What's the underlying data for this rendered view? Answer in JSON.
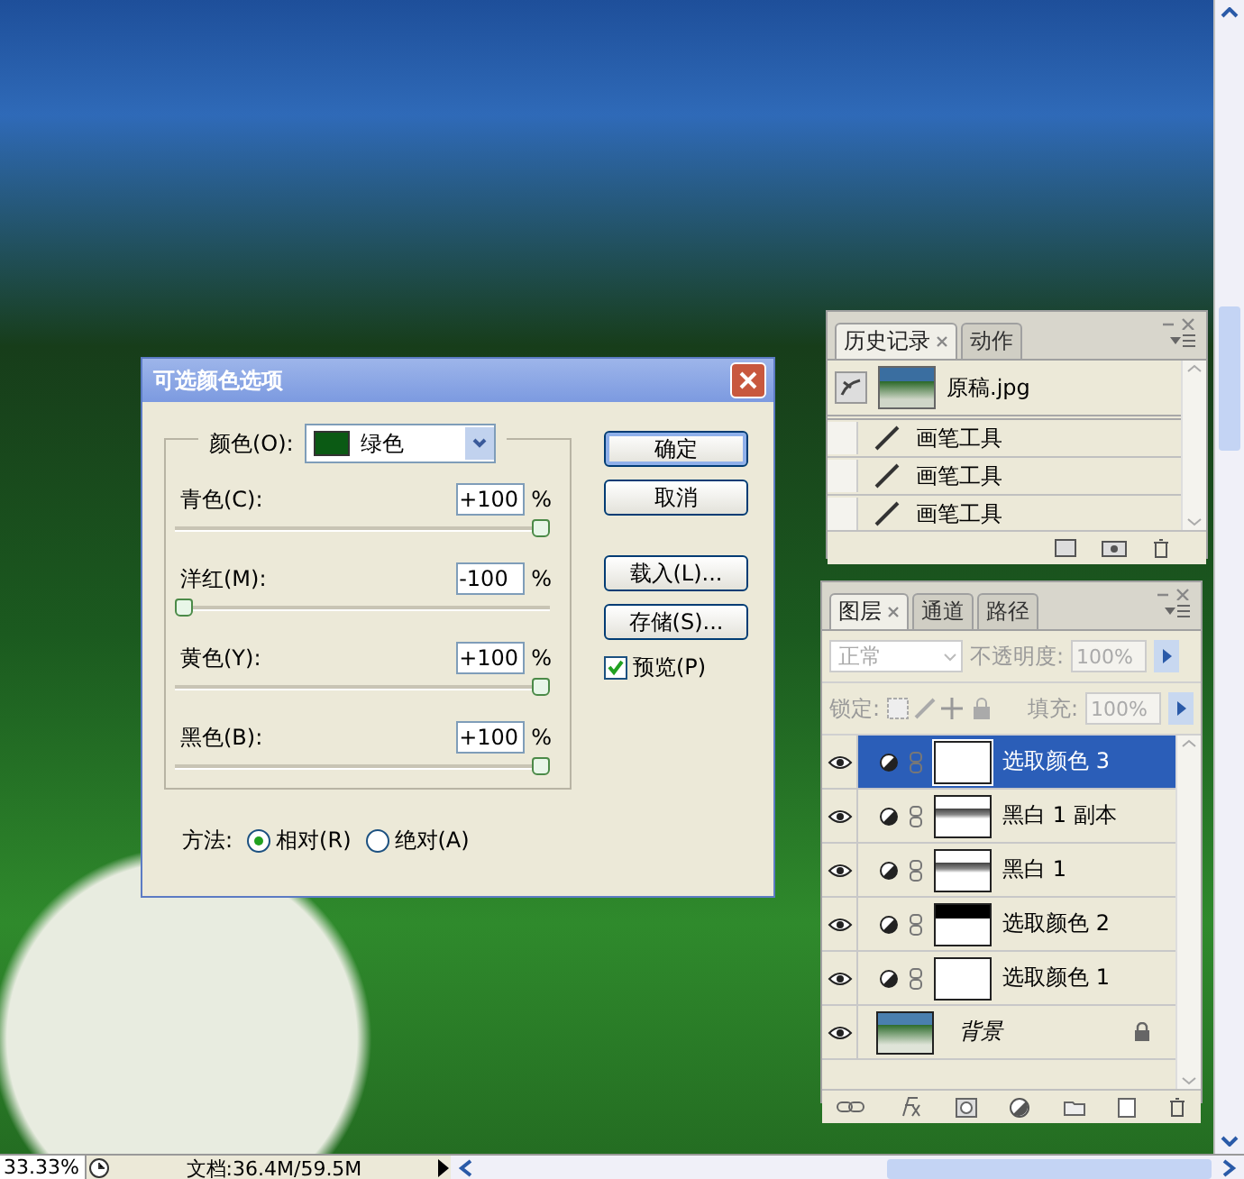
{
  "dialog": {
    "title": "可选颜色选项",
    "color_label": "颜色(O):",
    "color_value": "绿色",
    "sliders": [
      {
        "label": "青色(C):",
        "value": "+100",
        "unit": "%",
        "level": 1
      },
      {
        "label": "洋红(M):",
        "value": "-100",
        "unit": "%",
        "level": 0
      },
      {
        "label": "黄色(Y):",
        "value": "+100",
        "unit": "%",
        "level": 1
      },
      {
        "label": "黑色(B):",
        "value": "+100",
        "unit": "%",
        "level": 1
      }
    ],
    "buttons": [
      {
        "label": "确定",
        "default": true
      },
      {
        "label": "取消",
        "default": false
      },
      {
        "label": "载入(L)...",
        "default": false
      },
      {
        "label": "存储(S)...",
        "default": false
      }
    ],
    "preview": {
      "label": "预览(P)",
      "checked": true
    },
    "method": {
      "label": "方法:",
      "options": [
        {
          "label": "相对(R)",
          "selected": true
        },
        {
          "label": "绝对(A)",
          "selected": false
        }
      ]
    }
  },
  "history": {
    "tabs": [
      {
        "label": "历史记录",
        "selected": true
      },
      {
        "label": "动作",
        "selected": false
      }
    ],
    "snapshot": {
      "label": "原稿.jpg"
    },
    "items": [
      {
        "label": "画笔工具"
      },
      {
        "label": "画笔工具"
      },
      {
        "label": "画笔工具"
      }
    ]
  },
  "layers": {
    "tabs": [
      {
        "label": "图层",
        "selected": true
      },
      {
        "label": "通道",
        "selected": false
      },
      {
        "label": "路径",
        "selected": false
      }
    ],
    "blend_mode": "正常",
    "opacity_label": "不透明度:",
    "opacity": "100%",
    "lock_label": "锁定:",
    "fill_label": "填充:",
    "fill": "100%",
    "items": [
      {
        "name": "选取颜色 3",
        "kind": "blank",
        "selected": true
      },
      {
        "name": "黑白 1 副本",
        "kind": "skyline",
        "selected": false
      },
      {
        "name": "黑白 1",
        "kind": "skyline",
        "selected": false
      },
      {
        "name": "选取颜色 2",
        "kind": "topblack",
        "selected": false
      },
      {
        "name": "选取颜色 1",
        "kind": "blank",
        "selected": false
      },
      {
        "name": "背景",
        "kind": "background",
        "selected": false
      }
    ]
  },
  "status_bar": {
    "zoom": "33.33%",
    "doc_size": "文档:36.4M/59.5M"
  }
}
